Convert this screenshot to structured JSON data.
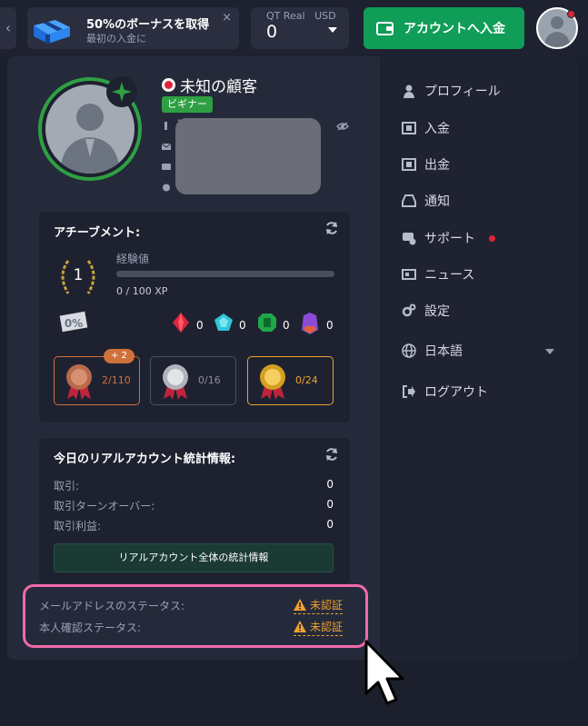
{
  "topbar": {
    "promo": {
      "title": "50%のボーナスを取得",
      "subtitle": "最初の入金に",
      "close": "×"
    },
    "account": {
      "label": "QT Real   USD",
      "balance": "0"
    },
    "deposit_label": "アカウントへ入金",
    "colors": {
      "accent": "#0f9d58",
      "alert": "#e0243a"
    }
  },
  "profile": {
    "name": "未知の顧客",
    "level_badge": "ビギナー",
    "id_prefix": "i"
  },
  "achievements": {
    "title": "アチーブメント:",
    "level": "1",
    "xp_label": "経験値",
    "xp_value": "0 / 100 XP",
    "xp_progress": 0,
    "gems": [
      {
        "name": "ruby",
        "count": "0",
        "color": "#e0243a"
      },
      {
        "name": "diamond",
        "count": "0",
        "color": "#2fc7d8"
      },
      {
        "name": "emerald",
        "count": "0",
        "color": "#1fa84a"
      },
      {
        "name": "amethyst",
        "count": "0",
        "color": "#8a4cd6"
      }
    ],
    "medals": [
      {
        "name": "bronze",
        "count": "2/110",
        "color": "#d0703a"
      },
      {
        "name": "silver",
        "count": "0/16",
        "color": "#8d8f96"
      },
      {
        "name": "gold",
        "count": "0/24",
        "color": "#f0a030"
      }
    ],
    "bonus_badge": "+ 2"
  },
  "stats": {
    "title": "今日のリアルアカウント統計情報:",
    "rows": [
      {
        "label": "取引:",
        "value": "0"
      },
      {
        "label": "取引ターンオーバー:",
        "value": "0"
      },
      {
        "label": "取引利益:",
        "value": "0"
      }
    ],
    "button": "リアルアカウント全体の統計情報"
  },
  "verification": [
    {
      "label": "メールアドレスのステータス:",
      "status": "未認証"
    },
    {
      "label": "本人確認ステータス:",
      "status": "未認証"
    }
  ],
  "menu": [
    {
      "label": "プロフィール",
      "icon": "user-icon"
    },
    {
      "label": "入金",
      "icon": "deposit-icon"
    },
    {
      "label": "出金",
      "icon": "withdraw-icon"
    },
    {
      "label": "通知",
      "icon": "inbox-icon"
    },
    {
      "label": "サポート",
      "icon": "support-icon"
    },
    {
      "label": "ニュース",
      "icon": "newspaper-icon"
    },
    {
      "label": "設定",
      "icon": "gears-icon"
    },
    {
      "label": "日本語",
      "icon": "globe-icon"
    },
    {
      "label": "ログアウト",
      "icon": "logout-icon"
    }
  ]
}
